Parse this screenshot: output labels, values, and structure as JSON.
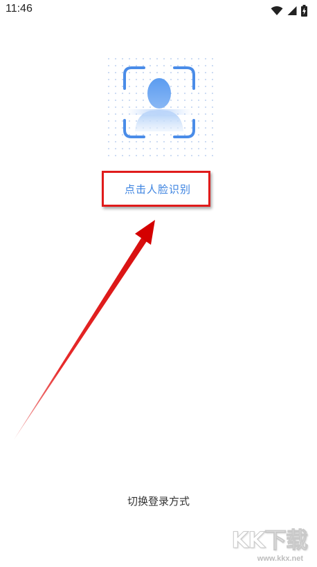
{
  "status_bar": {
    "time": "11:46",
    "icons": [
      "wifi-icon",
      "signal-icon",
      "battery-icon"
    ]
  },
  "face_recognition": {
    "icon": "face-scan-icon",
    "label": "点击人脸识别"
  },
  "switch_login": {
    "label": "切换登录方式"
  },
  "watermark": {
    "logo": "KK下载",
    "url": "www.kkx.net"
  },
  "colors": {
    "accent": "#3b82e0",
    "annotation_red": "#e01b1b"
  }
}
